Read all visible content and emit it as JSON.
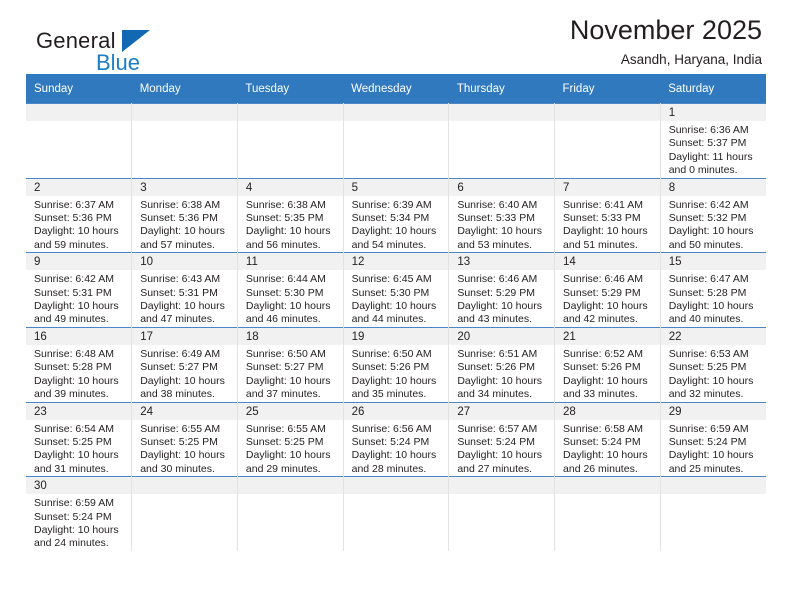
{
  "brand": {
    "name_part1": "General",
    "name_part2": "Blue"
  },
  "header": {
    "title": "November 2025",
    "location": "Asandh, Haryana, India"
  },
  "colors": {
    "header_blue": "#3079bf",
    "daynum_band": "#f1f1f1",
    "logo_blue": "#1b7ec6",
    "text": "#231f20"
  },
  "weekday_headers": [
    "Sunday",
    "Monday",
    "Tuesday",
    "Wednesday",
    "Thursday",
    "Friday",
    "Saturday"
  ],
  "weeks": [
    [
      {
        "day": "",
        "sunrise": "",
        "sunset": "",
        "daylight1": "",
        "daylight2": ""
      },
      {
        "day": "",
        "sunrise": "",
        "sunset": "",
        "daylight1": "",
        "daylight2": ""
      },
      {
        "day": "",
        "sunrise": "",
        "sunset": "",
        "daylight1": "",
        "daylight2": ""
      },
      {
        "day": "",
        "sunrise": "",
        "sunset": "",
        "daylight1": "",
        "daylight2": ""
      },
      {
        "day": "",
        "sunrise": "",
        "sunset": "",
        "daylight1": "",
        "daylight2": ""
      },
      {
        "day": "",
        "sunrise": "",
        "sunset": "",
        "daylight1": "",
        "daylight2": ""
      },
      {
        "day": "1",
        "sunrise": "Sunrise: 6:36 AM",
        "sunset": "Sunset: 5:37 PM",
        "daylight1": "Daylight: 11 hours",
        "daylight2": "and 0 minutes."
      }
    ],
    [
      {
        "day": "2",
        "sunrise": "Sunrise: 6:37 AM",
        "sunset": "Sunset: 5:36 PM",
        "daylight1": "Daylight: 10 hours",
        "daylight2": "and 59 minutes."
      },
      {
        "day": "3",
        "sunrise": "Sunrise: 6:38 AM",
        "sunset": "Sunset: 5:36 PM",
        "daylight1": "Daylight: 10 hours",
        "daylight2": "and 57 minutes."
      },
      {
        "day": "4",
        "sunrise": "Sunrise: 6:38 AM",
        "sunset": "Sunset: 5:35 PM",
        "daylight1": "Daylight: 10 hours",
        "daylight2": "and 56 minutes."
      },
      {
        "day": "5",
        "sunrise": "Sunrise: 6:39 AM",
        "sunset": "Sunset: 5:34 PM",
        "daylight1": "Daylight: 10 hours",
        "daylight2": "and 54 minutes."
      },
      {
        "day": "6",
        "sunrise": "Sunrise: 6:40 AM",
        "sunset": "Sunset: 5:33 PM",
        "daylight1": "Daylight: 10 hours",
        "daylight2": "and 53 minutes."
      },
      {
        "day": "7",
        "sunrise": "Sunrise: 6:41 AM",
        "sunset": "Sunset: 5:33 PM",
        "daylight1": "Daylight: 10 hours",
        "daylight2": "and 51 minutes."
      },
      {
        "day": "8",
        "sunrise": "Sunrise: 6:42 AM",
        "sunset": "Sunset: 5:32 PM",
        "daylight1": "Daylight: 10 hours",
        "daylight2": "and 50 minutes."
      }
    ],
    [
      {
        "day": "9",
        "sunrise": "Sunrise: 6:42 AM",
        "sunset": "Sunset: 5:31 PM",
        "daylight1": "Daylight: 10 hours",
        "daylight2": "and 49 minutes."
      },
      {
        "day": "10",
        "sunrise": "Sunrise: 6:43 AM",
        "sunset": "Sunset: 5:31 PM",
        "daylight1": "Daylight: 10 hours",
        "daylight2": "and 47 minutes."
      },
      {
        "day": "11",
        "sunrise": "Sunrise: 6:44 AM",
        "sunset": "Sunset: 5:30 PM",
        "daylight1": "Daylight: 10 hours",
        "daylight2": "and 46 minutes."
      },
      {
        "day": "12",
        "sunrise": "Sunrise: 6:45 AM",
        "sunset": "Sunset: 5:30 PM",
        "daylight1": "Daylight: 10 hours",
        "daylight2": "and 44 minutes."
      },
      {
        "day": "13",
        "sunrise": "Sunrise: 6:46 AM",
        "sunset": "Sunset: 5:29 PM",
        "daylight1": "Daylight: 10 hours",
        "daylight2": "and 43 minutes."
      },
      {
        "day": "14",
        "sunrise": "Sunrise: 6:46 AM",
        "sunset": "Sunset: 5:29 PM",
        "daylight1": "Daylight: 10 hours",
        "daylight2": "and 42 minutes."
      },
      {
        "day": "15",
        "sunrise": "Sunrise: 6:47 AM",
        "sunset": "Sunset: 5:28 PM",
        "daylight1": "Daylight: 10 hours",
        "daylight2": "and 40 minutes."
      }
    ],
    [
      {
        "day": "16",
        "sunrise": "Sunrise: 6:48 AM",
        "sunset": "Sunset: 5:28 PM",
        "daylight1": "Daylight: 10 hours",
        "daylight2": "and 39 minutes."
      },
      {
        "day": "17",
        "sunrise": "Sunrise: 6:49 AM",
        "sunset": "Sunset: 5:27 PM",
        "daylight1": "Daylight: 10 hours",
        "daylight2": "and 38 minutes."
      },
      {
        "day": "18",
        "sunrise": "Sunrise: 6:50 AM",
        "sunset": "Sunset: 5:27 PM",
        "daylight1": "Daylight: 10 hours",
        "daylight2": "and 37 minutes."
      },
      {
        "day": "19",
        "sunrise": "Sunrise: 6:50 AM",
        "sunset": "Sunset: 5:26 PM",
        "daylight1": "Daylight: 10 hours",
        "daylight2": "and 35 minutes."
      },
      {
        "day": "20",
        "sunrise": "Sunrise: 6:51 AM",
        "sunset": "Sunset: 5:26 PM",
        "daylight1": "Daylight: 10 hours",
        "daylight2": "and 34 minutes."
      },
      {
        "day": "21",
        "sunrise": "Sunrise: 6:52 AM",
        "sunset": "Sunset: 5:26 PM",
        "daylight1": "Daylight: 10 hours",
        "daylight2": "and 33 minutes."
      },
      {
        "day": "22",
        "sunrise": "Sunrise: 6:53 AM",
        "sunset": "Sunset: 5:25 PM",
        "daylight1": "Daylight: 10 hours",
        "daylight2": "and 32 minutes."
      }
    ],
    [
      {
        "day": "23",
        "sunrise": "Sunrise: 6:54 AM",
        "sunset": "Sunset: 5:25 PM",
        "daylight1": "Daylight: 10 hours",
        "daylight2": "and 31 minutes."
      },
      {
        "day": "24",
        "sunrise": "Sunrise: 6:55 AM",
        "sunset": "Sunset: 5:25 PM",
        "daylight1": "Daylight: 10 hours",
        "daylight2": "and 30 minutes."
      },
      {
        "day": "25",
        "sunrise": "Sunrise: 6:55 AM",
        "sunset": "Sunset: 5:25 PM",
        "daylight1": "Daylight: 10 hours",
        "daylight2": "and 29 minutes."
      },
      {
        "day": "26",
        "sunrise": "Sunrise: 6:56 AM",
        "sunset": "Sunset: 5:24 PM",
        "daylight1": "Daylight: 10 hours",
        "daylight2": "and 28 minutes."
      },
      {
        "day": "27",
        "sunrise": "Sunrise: 6:57 AM",
        "sunset": "Sunset: 5:24 PM",
        "daylight1": "Daylight: 10 hours",
        "daylight2": "and 27 minutes."
      },
      {
        "day": "28",
        "sunrise": "Sunrise: 6:58 AM",
        "sunset": "Sunset: 5:24 PM",
        "daylight1": "Daylight: 10 hours",
        "daylight2": "and 26 minutes."
      },
      {
        "day": "29",
        "sunrise": "Sunrise: 6:59 AM",
        "sunset": "Sunset: 5:24 PM",
        "daylight1": "Daylight: 10 hours",
        "daylight2": "and 25 minutes."
      }
    ],
    [
      {
        "day": "30",
        "sunrise": "Sunrise: 6:59 AM",
        "sunset": "Sunset: 5:24 PM",
        "daylight1": "Daylight: 10 hours",
        "daylight2": "and 24 minutes."
      },
      {
        "day": "",
        "sunrise": "",
        "sunset": "",
        "daylight1": "",
        "daylight2": ""
      },
      {
        "day": "",
        "sunrise": "",
        "sunset": "",
        "daylight1": "",
        "daylight2": ""
      },
      {
        "day": "",
        "sunrise": "",
        "sunset": "",
        "daylight1": "",
        "daylight2": ""
      },
      {
        "day": "",
        "sunrise": "",
        "sunset": "",
        "daylight1": "",
        "daylight2": ""
      },
      {
        "day": "",
        "sunrise": "",
        "sunset": "",
        "daylight1": "",
        "daylight2": ""
      },
      {
        "day": "",
        "sunrise": "",
        "sunset": "",
        "daylight1": "",
        "daylight2": ""
      }
    ]
  ]
}
